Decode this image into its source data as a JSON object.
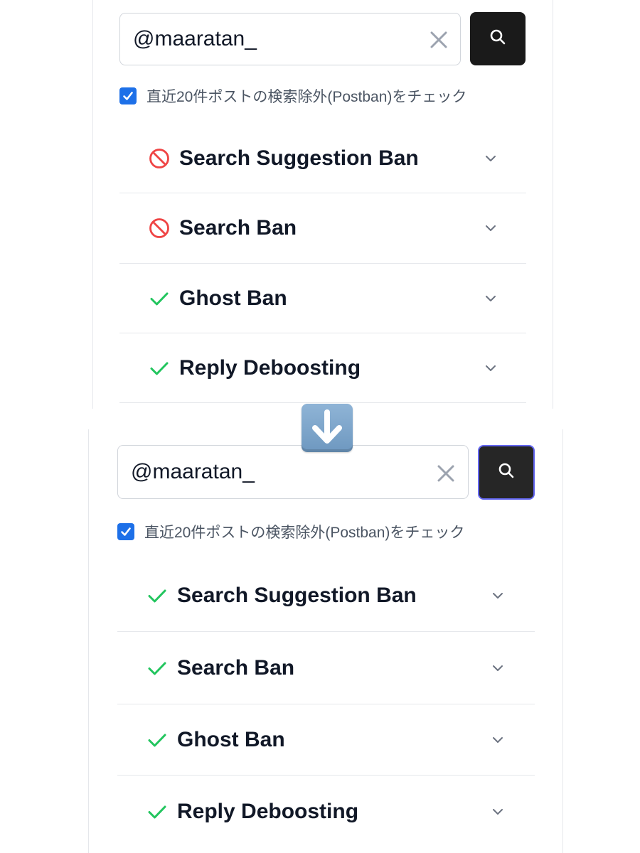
{
  "colors": {
    "ban_red": "#ef4444",
    "ok_green": "#22c55e",
    "checkbox_blue": "#1d70e8",
    "button_dark": "#1a1a1a",
    "button_focus_border": "#6366f1"
  },
  "arrow": {
    "icon": "down-arrow-emoji"
  },
  "panels": [
    {
      "search": {
        "value": "@maaratan_",
        "clear_icon": "close-icon",
        "button_icon": "search-icon"
      },
      "postban_check": {
        "checked": true,
        "label": "直近20件ポストの検索除外(Postban)をチェック"
      },
      "results": [
        {
          "label": "Search Suggestion Ban",
          "status": "banned",
          "icon": "ban-icon"
        },
        {
          "label": "Search Ban",
          "status": "banned",
          "icon": "ban-icon"
        },
        {
          "label": "Ghost Ban",
          "status": "ok",
          "icon": "check-icon"
        },
        {
          "label": "Reply Deboosting",
          "status": "ok",
          "icon": "check-icon"
        }
      ]
    },
    {
      "search": {
        "value": "@maaratan_",
        "clear_icon": "close-icon",
        "button_icon": "search-icon"
      },
      "postban_check": {
        "checked": true,
        "label": "直近20件ポストの検索除外(Postban)をチェック"
      },
      "results": [
        {
          "label": "Search Suggestion Ban",
          "status": "ok",
          "icon": "check-icon"
        },
        {
          "label": "Search Ban",
          "status": "ok",
          "icon": "check-icon"
        },
        {
          "label": "Ghost Ban",
          "status": "ok",
          "icon": "check-icon"
        },
        {
          "label": "Reply Deboosting",
          "status": "ok",
          "icon": "check-icon"
        }
      ]
    }
  ]
}
